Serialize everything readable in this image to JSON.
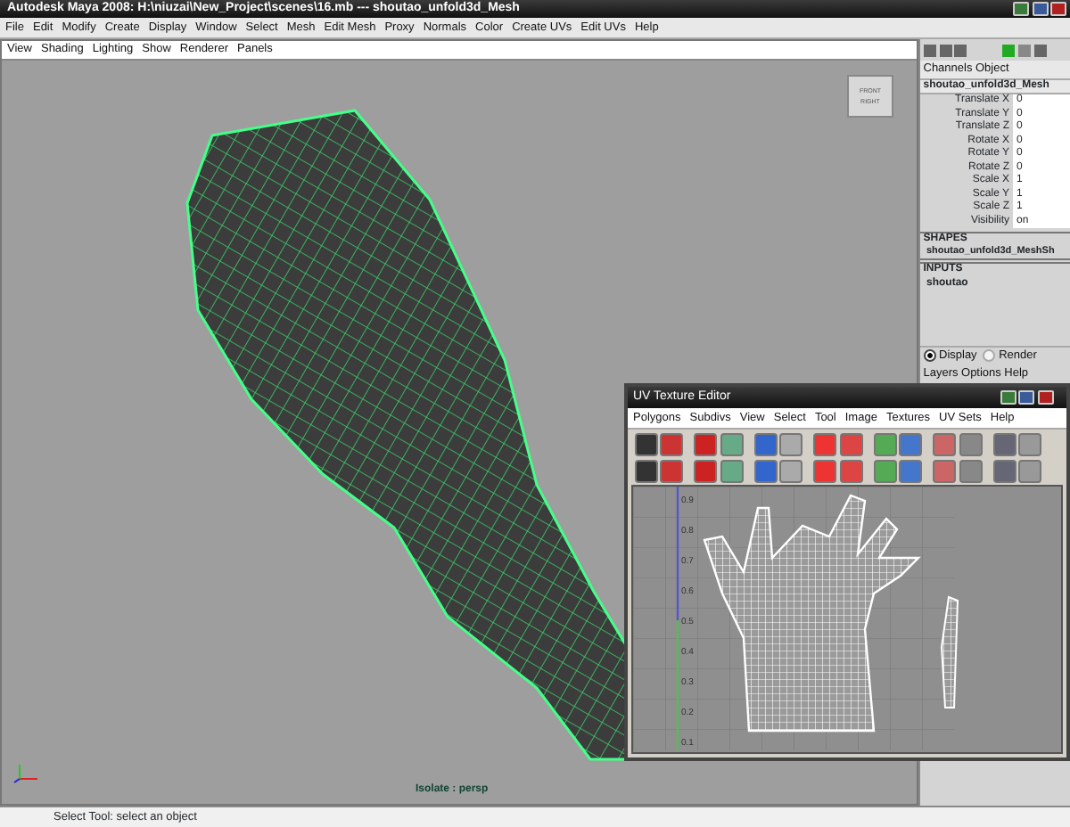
{
  "window": {
    "title": "Autodesk Maya 2008: H:\\niuzai\\New_Project\\scenes\\16.mb   ---   shoutao_unfold3d_Mesh"
  },
  "menu_bar": [
    "File",
    "Edit",
    "Modify",
    "Create",
    "Display",
    "Window",
    "Select",
    "Mesh",
    "Edit Mesh",
    "Proxy",
    "Normals",
    "Color",
    "Create UVs",
    "Edit UVs",
    "Help"
  ],
  "viewport": {
    "menu": [
      "View",
      "Shading",
      "Lighting",
      "Show",
      "Renderer",
      "Panels"
    ],
    "viewcube": [
      "FRONT",
      "RIGHT"
    ],
    "camera_label": "Isolate : persp"
  },
  "channel_box": {
    "menu": [
      "Channels",
      "Object"
    ],
    "object": "shoutao_unfold3d_Mesh",
    "attributes": [
      {
        "name": "Translate X",
        "value": "0"
      },
      {
        "name": "Translate Y",
        "value": "0"
      },
      {
        "name": "Translate Z",
        "value": "0"
      },
      {
        "name": "Rotate X",
        "value": "0"
      },
      {
        "name": "Rotate Y",
        "value": "0"
      },
      {
        "name": "Rotate Z",
        "value": "0"
      },
      {
        "name": "Scale X",
        "value": "1"
      },
      {
        "name": "Scale Y",
        "value": "1"
      },
      {
        "name": "Scale Z",
        "value": "1"
      },
      {
        "name": "Visibility",
        "value": "on"
      }
    ],
    "shapes_header": "SHAPES",
    "shape": "shoutao_unfold3d_MeshSh",
    "inputs_header": "INPUTS",
    "input": "shoutao"
  },
  "layer_editor": {
    "modes": [
      {
        "label": "Display",
        "selected": true
      },
      {
        "label": "Render",
        "selected": false
      }
    ],
    "menu": [
      "Layers",
      "Options",
      "Help"
    ]
  },
  "uv_editor": {
    "title": "UV Texture Editor",
    "menu": [
      "Polygons",
      "Subdivs",
      "View",
      "Select",
      "Tool",
      "Image",
      "Textures",
      "UV Sets",
      "Help"
    ],
    "grid_labels": [
      "0.9",
      "0.8",
      "0.7",
      "0.6",
      "0.5",
      "0.4",
      "0.3",
      "0.2",
      "0.1"
    ]
  },
  "status_line": "Select Tool: select an object"
}
